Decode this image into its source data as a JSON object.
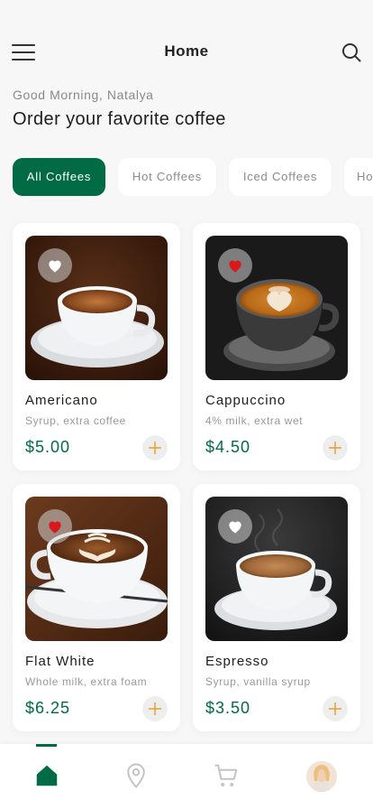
{
  "header": {
    "title": "Home",
    "menu_icon": "hamburger-menu-icon",
    "search_icon": "search-icon"
  },
  "greeting": "Good Morning, Natalya",
  "headline": "Order your favorite coffee",
  "categories": [
    {
      "label": "All Coffees",
      "active": true
    },
    {
      "label": "Hot Coffees",
      "active": false
    },
    {
      "label": "Iced Coffees",
      "active": false
    },
    {
      "label": "Ho",
      "active": false
    }
  ],
  "products": [
    {
      "name": "Americano",
      "description": "Syrup, extra coffee",
      "price": "$5.00",
      "favorite": false
    },
    {
      "name": "Cappuccino",
      "description": "4% milk, extra wet",
      "price": "$4.50",
      "favorite": true
    },
    {
      "name": "Flat White",
      "description": "Whole milk, extra foam",
      "price": "$6.25",
      "favorite": true
    },
    {
      "name": "Espresso",
      "description": "Syrup, vanilla syrup",
      "price": "$3.50",
      "favorite": false
    }
  ],
  "bottom_nav": [
    {
      "icon": "home-icon",
      "active": true
    },
    {
      "icon": "location-pin-icon",
      "active": false
    },
    {
      "icon": "cart-icon",
      "active": false
    },
    {
      "icon": "profile-avatar",
      "active": false
    }
  ],
  "colors": {
    "brand_green": "#006b45",
    "favorite_red": "#d7191c",
    "add_plus_orange": "#e8a33c",
    "background": "#f7f7f7"
  }
}
